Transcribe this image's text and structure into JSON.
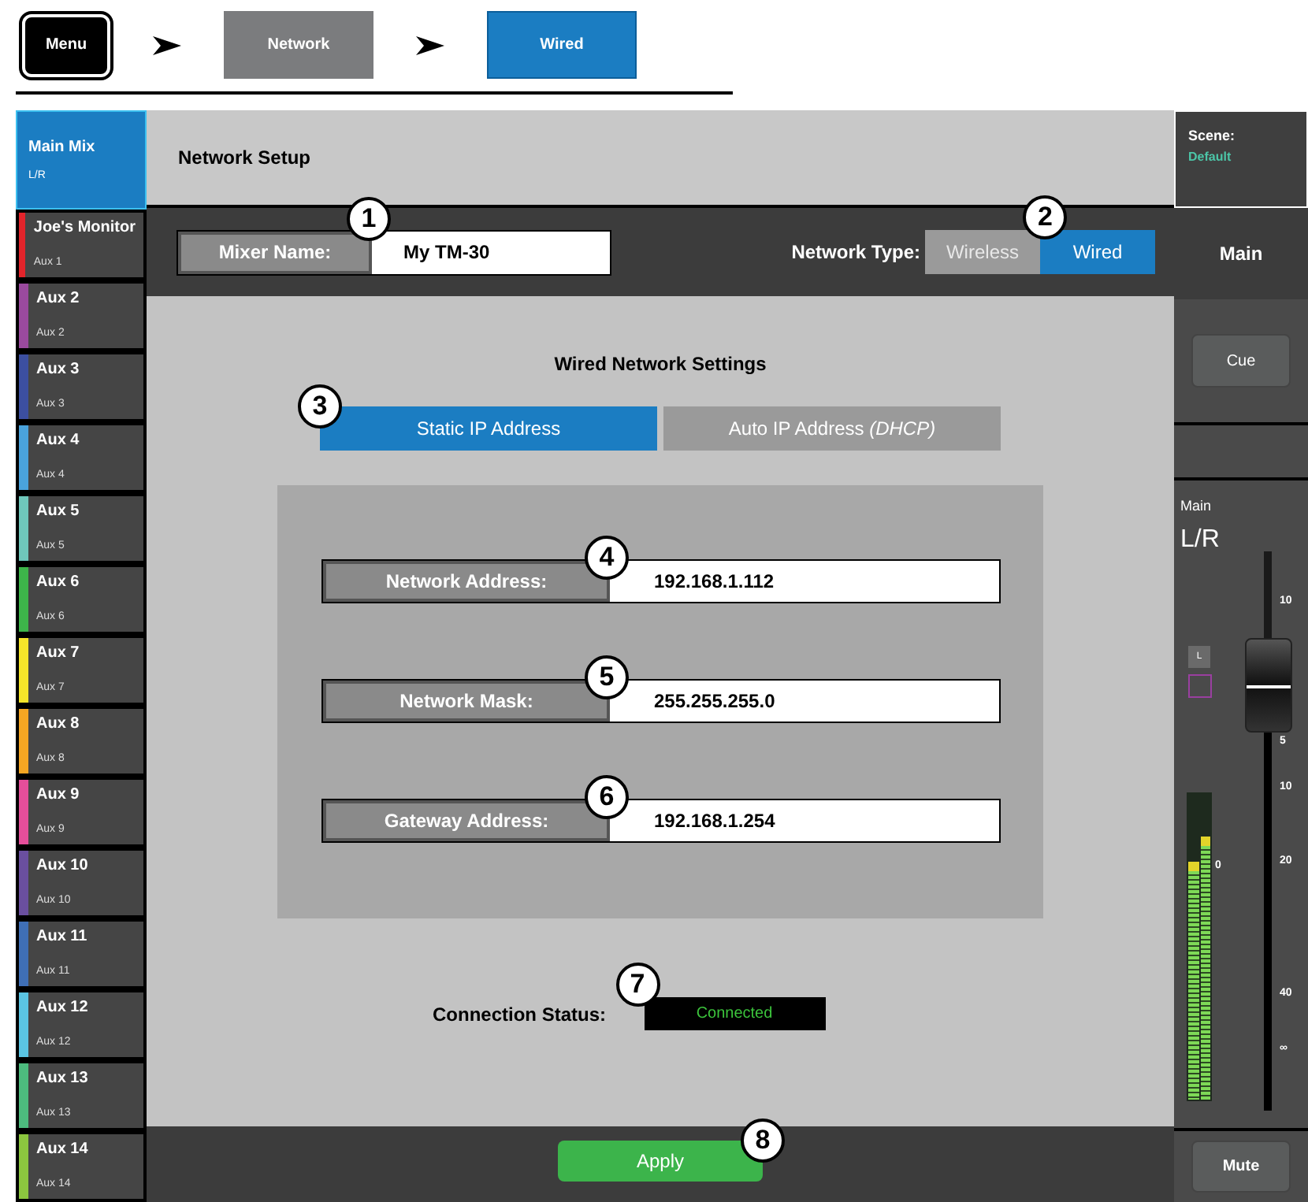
{
  "breadcrumb": [
    {
      "label": "Menu",
      "kind": "menu"
    },
    {
      "label": "Network",
      "kind": "section"
    },
    {
      "label": "Wired",
      "kind": "current"
    }
  ],
  "mixes": [
    {
      "name": "Main Mix",
      "sub": "L/R",
      "selected": true,
      "color": "#1b7dc2"
    },
    {
      "name": "Joe's Monitor",
      "sub": "Aux 1",
      "selected": false,
      "color": "#e3242b"
    },
    {
      "name": "Aux 2",
      "sub": "Aux 2",
      "selected": false,
      "color": "#9a4a9e"
    },
    {
      "name": "Aux 3",
      "sub": "Aux 3",
      "selected": false,
      "color": "#3c4fa0"
    },
    {
      "name": "Aux 4",
      "sub": "Aux 4",
      "selected": false,
      "color": "#4aa3dc"
    },
    {
      "name": "Aux 5",
      "sub": "Aux 5",
      "selected": false,
      "color": "#6fc7bb"
    },
    {
      "name": "Aux 6",
      "sub": "Aux 6",
      "selected": false,
      "color": "#3db54a"
    },
    {
      "name": "Aux 7",
      "sub": "Aux 7",
      "selected": false,
      "color": "#f5e52a"
    },
    {
      "name": "Aux 8",
      "sub": "Aux 8",
      "selected": false,
      "color": "#f5a623"
    },
    {
      "name": "Aux 9",
      "sub": "Aux 9",
      "selected": false,
      "color": "#e54e9a"
    },
    {
      "name": "Aux 10",
      "sub": "Aux 10",
      "selected": false,
      "color": "#6a4f9f"
    },
    {
      "name": "Aux 11",
      "sub": "Aux 11",
      "selected": false,
      "color": "#3f6fb6"
    },
    {
      "name": "Aux 12",
      "sub": "Aux 12",
      "selected": false,
      "color": "#5bc5e3"
    },
    {
      "name": "Aux 13",
      "sub": "Aux 13",
      "selected": false,
      "color": "#4dbb7e"
    },
    {
      "name": "Aux 14",
      "sub": "Aux 14",
      "selected": false,
      "color": "#8cc63f"
    }
  ],
  "header": {
    "title": "Network Setup"
  },
  "mixer_name": {
    "label": "Mixer Name:",
    "value": "My TM-30",
    "callout": "1"
  },
  "network_type": {
    "label": "Network Type:",
    "callout": "2",
    "options": [
      {
        "label": "Wireless",
        "selected": false
      },
      {
        "label": "Wired",
        "selected": true
      }
    ]
  },
  "wired_settings": {
    "title": "Wired Network Settings",
    "callout": "3",
    "modes": [
      {
        "label": "Static IP Address",
        "selected": true
      },
      {
        "label": "Auto IP Address *(DHCP)*",
        "selected": false
      }
    ],
    "fields": [
      {
        "label": "Network Address:",
        "value": "192.168.1.112",
        "callout": "4"
      },
      {
        "label": "Network Mask:",
        "value": "255.255.255.0",
        "callout": "5"
      },
      {
        "label": "Gateway Address:",
        "value": "192.168.1.254",
        "callout": "6"
      }
    ]
  },
  "connection": {
    "label": "Connection Status:",
    "value": "Connected",
    "callout": "7"
  },
  "apply": {
    "label": "Apply",
    "callout": "8"
  },
  "right_panel": {
    "scene_label": "Scene:",
    "scene_value": "Default",
    "main_tab": "Main",
    "cue": "Cue",
    "strip_label": "Main",
    "strip_name": "L/R",
    "channel_tag": "L",
    "fader": {
      "level": 0.76
    },
    "meters": [
      {
        "level": 0.78
      },
      {
        "level": 0.86
      }
    ],
    "scale": [
      "10",
      "5",
      "10",
      "20",
      "40",
      "∞"
    ],
    "meter_zero": "0",
    "mute": "Mute"
  }
}
